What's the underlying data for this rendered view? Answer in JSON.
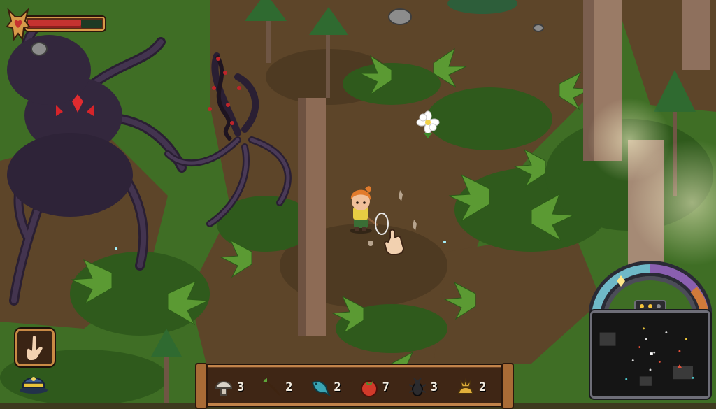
{
  "hud": {
    "health": {
      "fraction": 0.72
    },
    "tool": {
      "icon": "bare-hand-icon"
    },
    "secondary_tool": {
      "icon": "helmet-icon"
    }
  },
  "hotbar": {
    "items": [
      {
        "icon": "mushroom-icon",
        "count": "3"
      },
      {
        "icon": "carrot-icon",
        "count": "2"
      },
      {
        "icon": "fish-icon",
        "count": "2"
      },
      {
        "icon": "tomato-icon",
        "count": "7"
      },
      {
        "icon": "beetle-icon",
        "count": "3"
      },
      {
        "icon": "flower-bulb-icon",
        "count": "2"
      }
    ]
  },
  "minimap": {
    "icon": "minimap-display"
  },
  "colors": {
    "hud_frame": "#c1834a",
    "health_red": "#c53230",
    "ground": "#5b4327",
    "grass": "#3f7a2a",
    "tentacle": "#3b2d45"
  }
}
